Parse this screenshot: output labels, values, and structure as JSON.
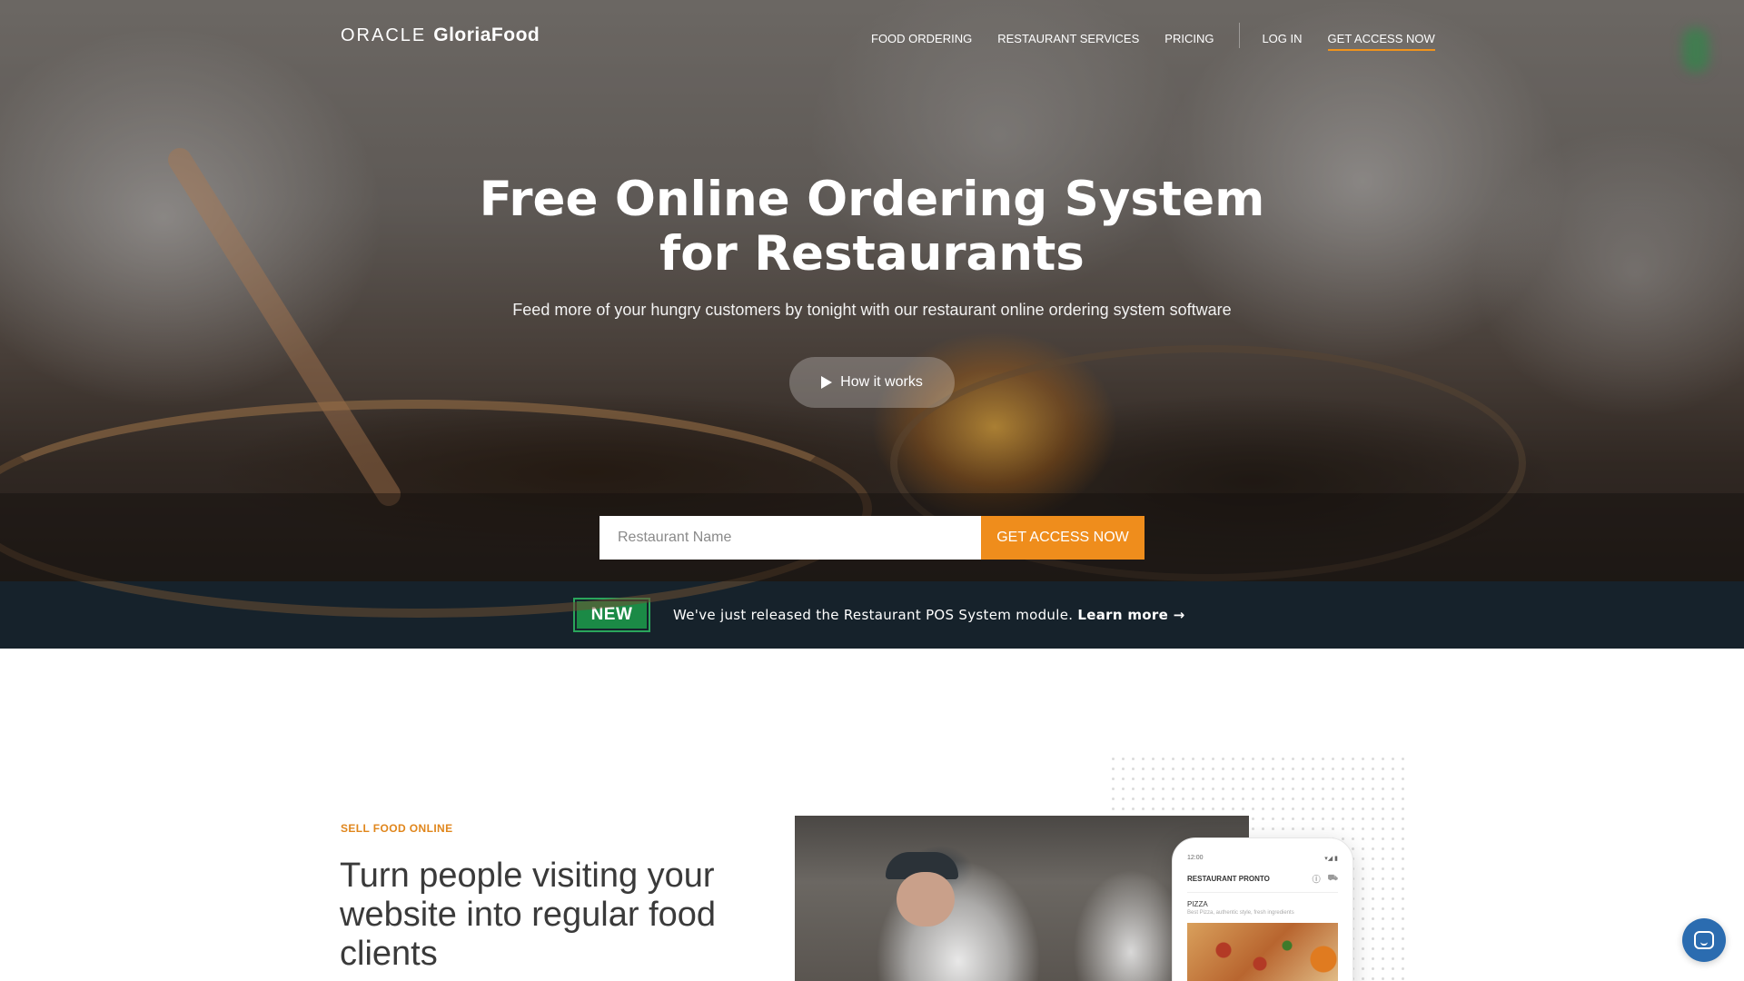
{
  "brand": {
    "oracle": "ORACLE",
    "product": "GloriaFood"
  },
  "nav": {
    "items": [
      "FOOD ORDERING",
      "RESTAURANT SERVICES",
      "PRICING"
    ],
    "login": "LOG IN",
    "cta": "GET ACCESS NOW"
  },
  "hero": {
    "title_line1": "Free Online Ordering System",
    "title_line2": "for Restaurants",
    "subtitle": "Feed more of your hungry customers by tonight with our restaurant online ordering system software",
    "how_it_works": "How it works",
    "input_placeholder": "Restaurant Name",
    "access_button": "GET ACCESS NOW"
  },
  "announcement": {
    "badge": "NEW",
    "text": "We've just released the Restaurant POS System module.",
    "link": "Learn more →"
  },
  "section": {
    "eyebrow": "SELL FOOD ONLINE",
    "title": "Turn people visiting your website into regular food clients"
  },
  "phone": {
    "time": "12:00",
    "signal": "▾◢ ▮",
    "restaurant": "RESTAURANT PRONTO",
    "category": "PIZZA",
    "description": "Best Pizza, authentic style, fresh ingredients"
  },
  "colors": {
    "accent": "#ef8d1c",
    "announce_bg": "#16222b",
    "badge_green": "#1b8a46",
    "chat_blue": "#2b6cb0"
  }
}
